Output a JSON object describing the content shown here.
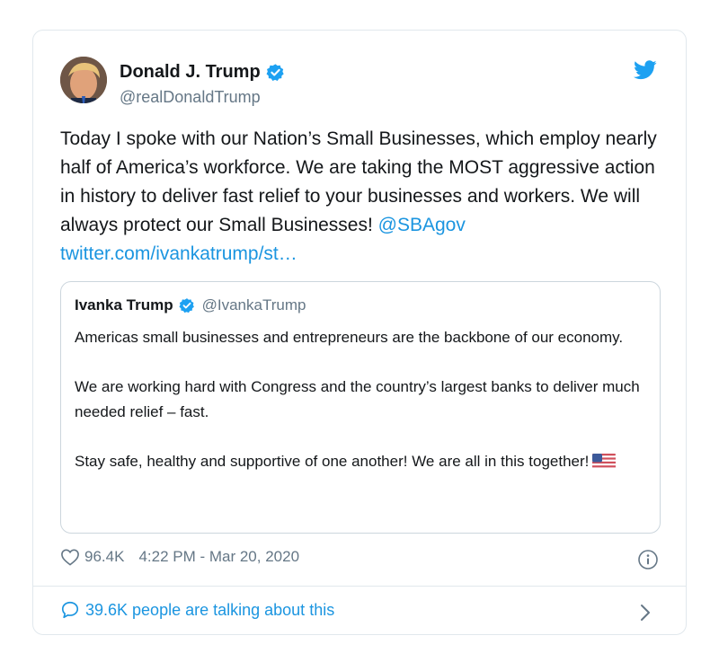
{
  "tweet": {
    "author": {
      "name": "Donald J. Trump",
      "handle": "@realDonaldTrump",
      "verified": true
    },
    "text": "Today I spoke with our Nation’s Small Businesses, which employ nearly half of America’s workforce. We are taking the MOST aggressive action in history to deliver fast relief to your businesses and workers. We will always protect our Small Businesses!",
    "mention": "@SBAgov",
    "link": "twitter.com/ivankatrump/st…",
    "quoted": {
      "name": "Ivanka Trump",
      "handle": "@IvankaTrump",
      "verified": true,
      "paragraphs": [
        "Americas small businesses and entrepreneurs are the backbone of our economy.",
        "We are working hard with Congress and the country’s largest banks to deliver much needed relief – fast.",
        "Stay safe, healthy and supportive of one another! We are all in this together!"
      ],
      "emoji": "us-flag-icon"
    },
    "likes": "96.4K",
    "timestamp": "4:22 PM - Mar 20, 2020",
    "talking": "39.6K people are talking about this"
  },
  "colors": {
    "accent": "#1b95e0",
    "verified": "#1da1f2",
    "muted": "#657786",
    "border": "#e1e8ed"
  },
  "icons": [
    "verified-badge-icon",
    "twitter-bird-icon",
    "heart-icon",
    "info-icon",
    "comment-bubble-icon",
    "chevron-right-icon"
  ]
}
